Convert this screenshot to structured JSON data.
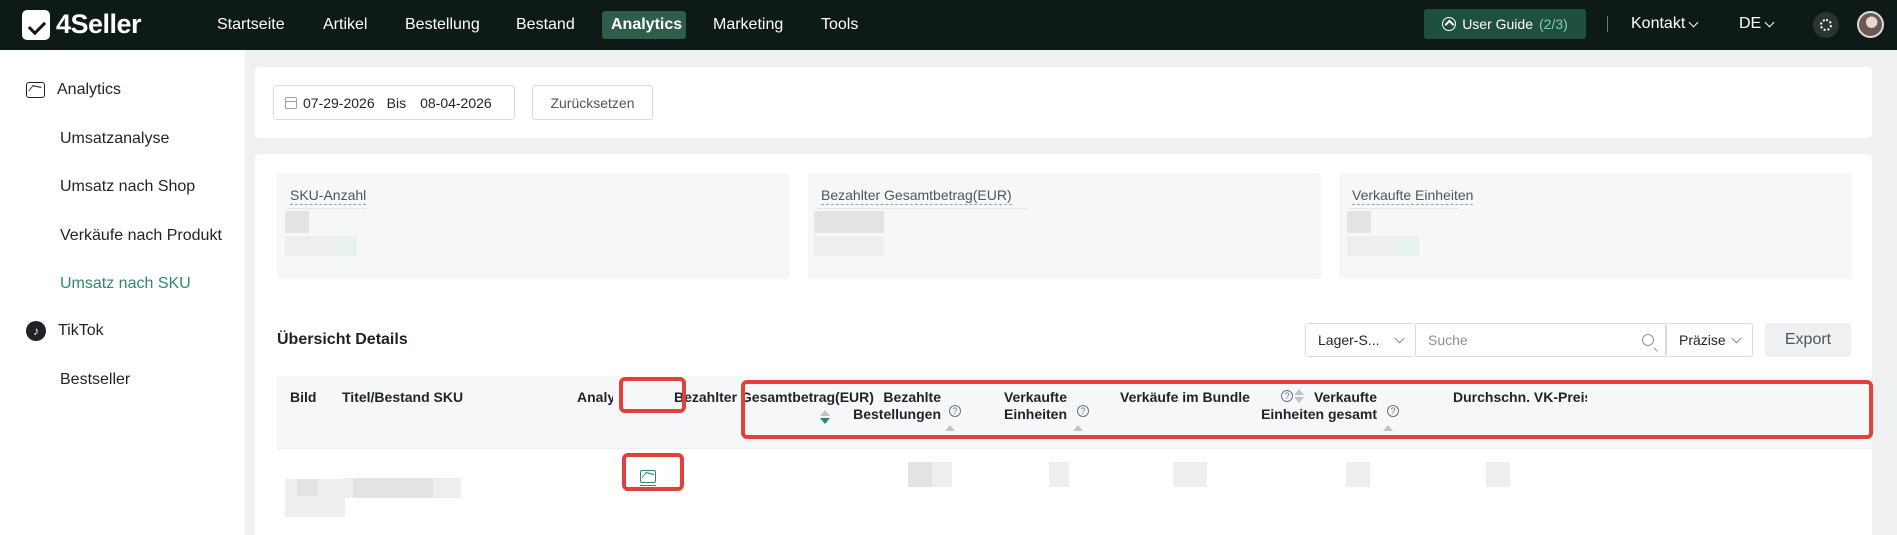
{
  "brand": {
    "name": "4Seller"
  },
  "nav": {
    "items": [
      "Startseite",
      "Artikel",
      "Bestellung",
      "Bestand",
      "Analytics",
      "Marketing",
      "Tools"
    ],
    "active_index": 4,
    "guide_label": "User Guide",
    "guide_progress": "(2/3)",
    "contact_label": "Kontakt",
    "lang_label": "DE"
  },
  "sidebar": {
    "analytics_label": "Analytics",
    "analytics_items": [
      "Umsatzanalyse",
      "Umsatz nach Shop",
      "Verkäufe nach Produkt",
      "Umsatz nach SKU"
    ],
    "active_item": "Umsatz nach SKU",
    "tiktok_label": "TikTok",
    "tiktok_items": [
      "Bestseller"
    ]
  },
  "filter": {
    "date_from": "07-29-2026",
    "date_sep": "Bis",
    "date_to": "08-04-2026",
    "reset_label": "Zurücksetzen"
  },
  "kpis": [
    {
      "label": "SKU-Anzahl"
    },
    {
      "label": "Bezahlter Gesamtbetrag(EUR)"
    },
    {
      "label": "Verkaufte Einheiten"
    }
  ],
  "details": {
    "title": "Übersicht Details",
    "warehouse_select": "Lager-S...",
    "search_placeholder": "Suche",
    "match_select": "Präzise",
    "export_label": "Export"
  },
  "table": {
    "col_image": "Bild",
    "col_title": "Titel/Bestand SKU",
    "col_analysis": "Analyse",
    "col_paid_total": "Bezahlter Gesamtbetrag(EUR)",
    "col_paid_orders_1": "Bezahlte",
    "col_paid_orders_2": "Bestellungen",
    "col_units_1": "Verkaufte",
    "col_units_2": "Einheiten",
    "col_bundle": "Verkäufe im Bundle",
    "col_units_total_1": "Verkaufte",
    "col_units_total_2": "Einheiten gesamt",
    "col_avg_price": "Durchschn. VK-Preis(EUR)"
  },
  "colors": {
    "accent": "#2f8a6a",
    "nav_bg": "#0e1a17",
    "highlight": "#e1413b"
  }
}
